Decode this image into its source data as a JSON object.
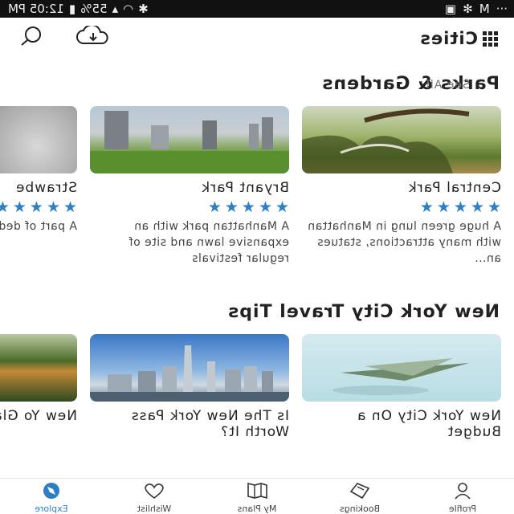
{
  "status": {
    "time": "12:05 PM",
    "battery": "55%",
    "dots": "···"
  },
  "app": {
    "name": "Cities"
  },
  "sections": [
    {
      "title": "Parks & Gardens",
      "see_all": "See All",
      "cards": [
        {
          "title": "Central Park",
          "rating": 5,
          "desc": "A huge green lung in Manhattan with many attractions, statues an..."
        },
        {
          "title": "Bryant Park",
          "rating": 5,
          "desc": "A Manhattan park with an expansive lawn and site of regular festivals"
        },
        {
          "title": "Strawbe",
          "rating": 5,
          "desc": "A part of dedicate Lennon"
        }
      ]
    },
    {
      "title": "New York City Travel Tips",
      "cards": [
        {
          "title": "New York City On a Budget"
        },
        {
          "title": "Is The New York Pass Worth It?"
        },
        {
          "title": "New Yo Glance"
        }
      ]
    }
  ],
  "tabs": [
    "Explore",
    "Wishlist",
    "My Plans",
    "Bookings",
    "Profile"
  ],
  "colors": {
    "accent": "#2a7fc6",
    "star": "#2a7fc6"
  }
}
